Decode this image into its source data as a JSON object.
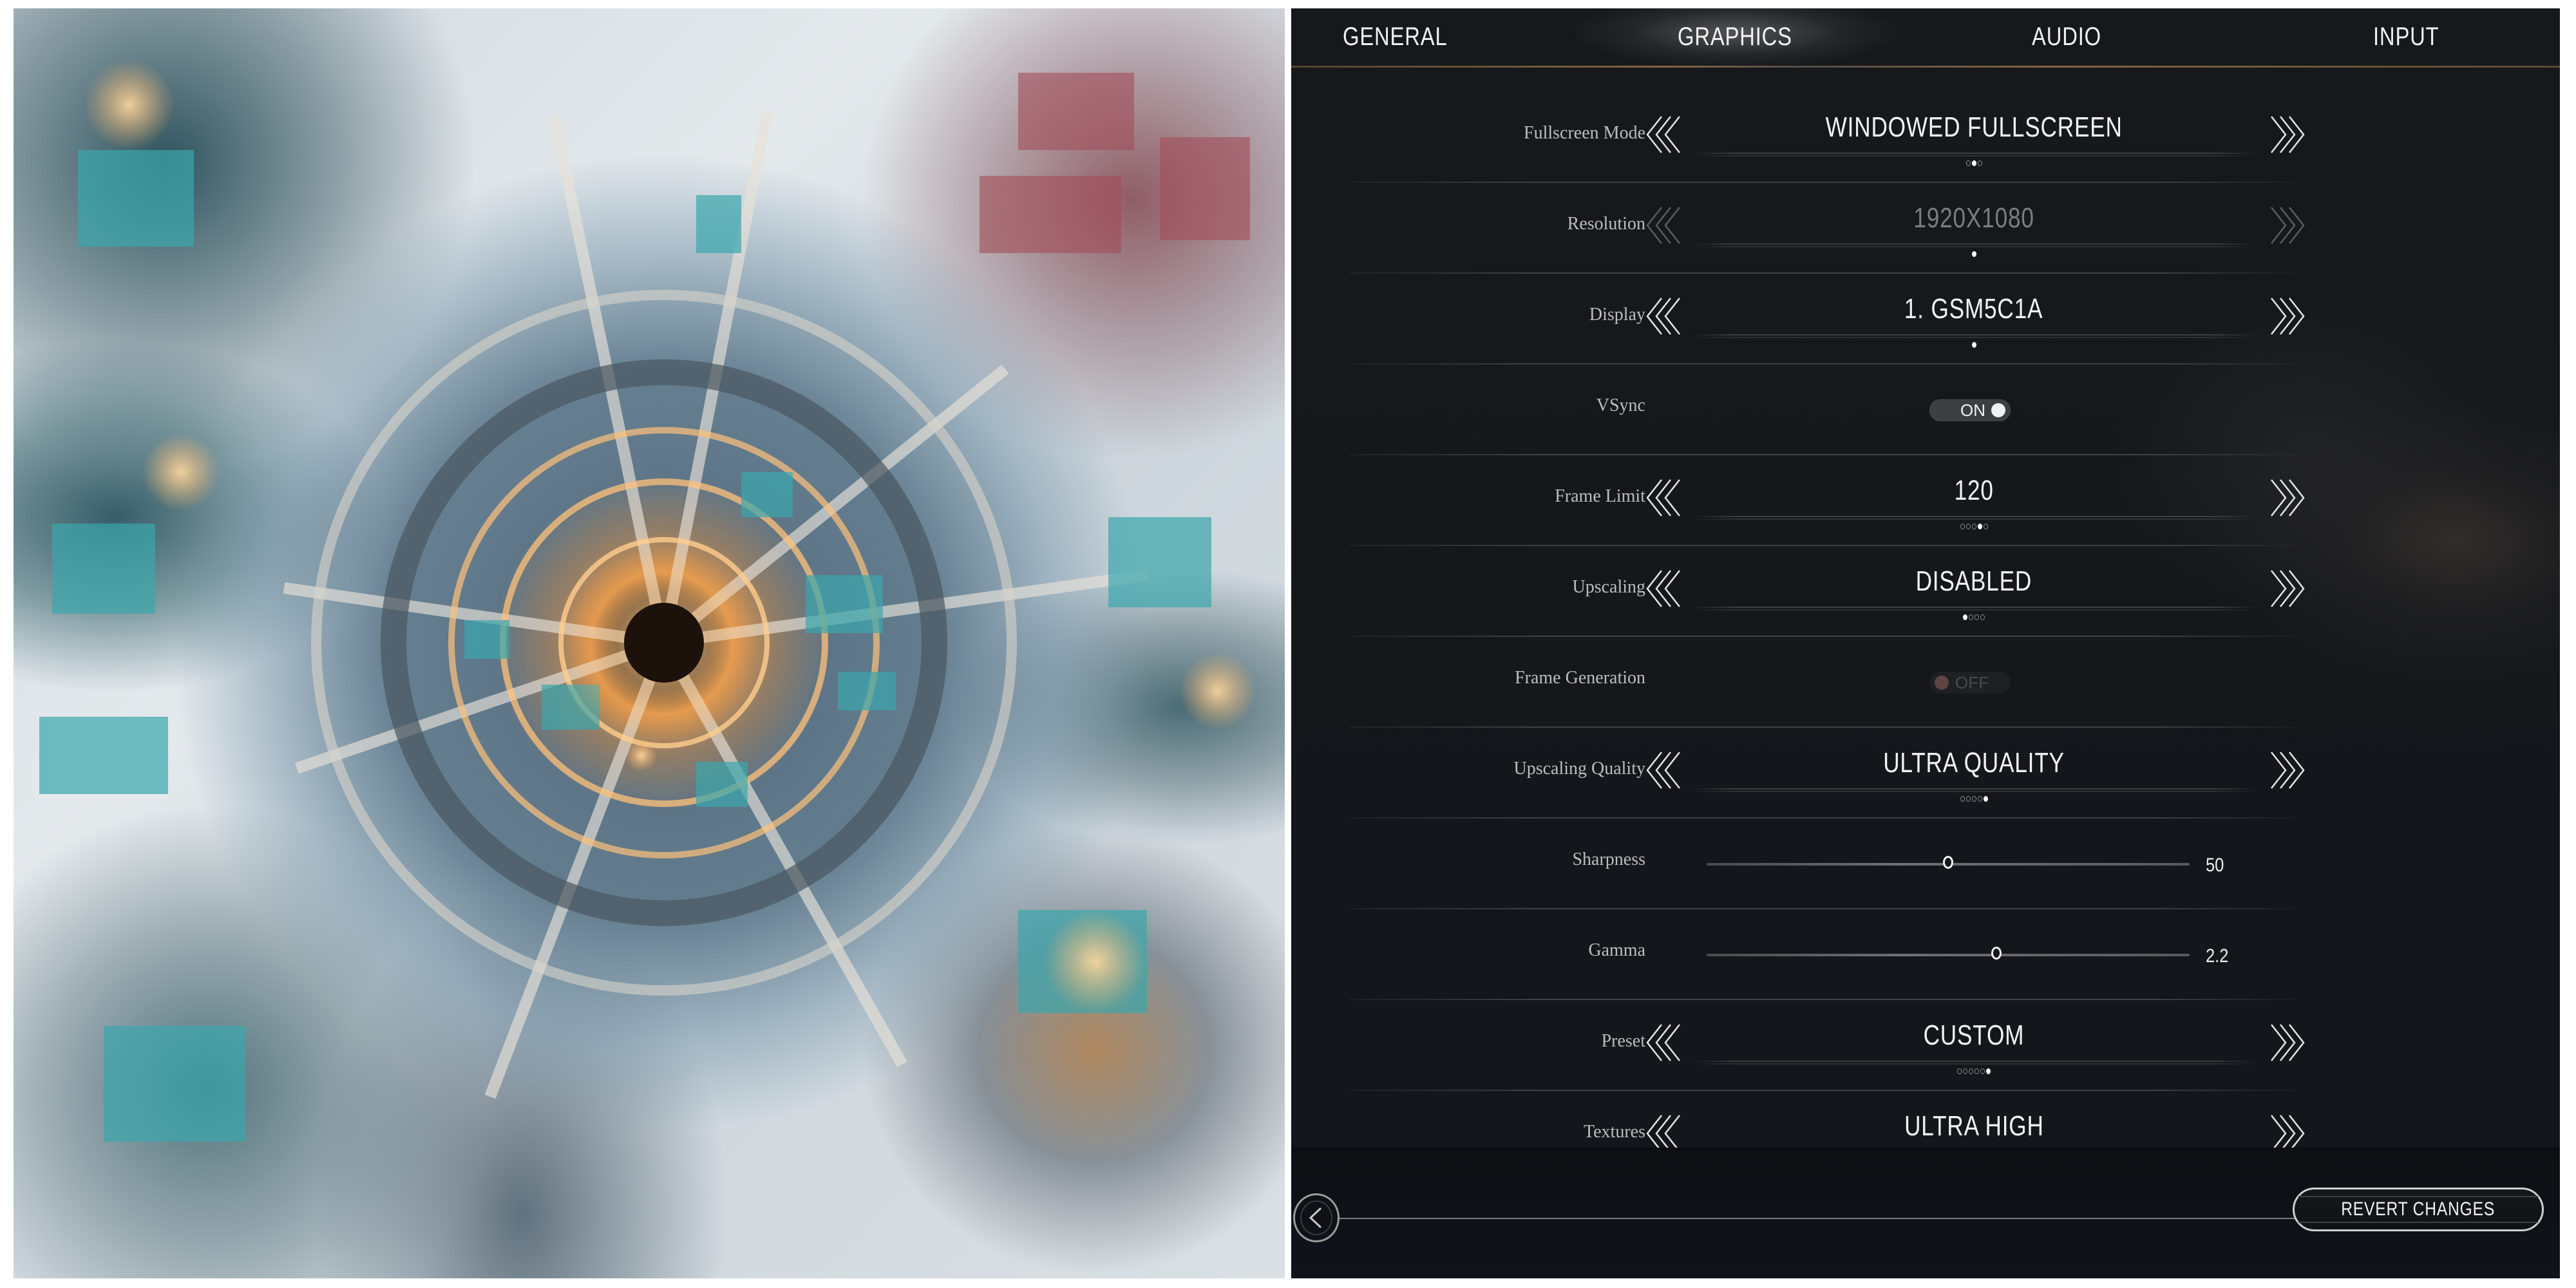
{
  "artwork": {
    "description": "Aerial view of a snowy frost-covered city with a glowing central generator"
  },
  "tabs": [
    {
      "label": "GENERAL",
      "active": false
    },
    {
      "label": "GRAPHICS",
      "active": true
    },
    {
      "label": "AUDIO",
      "active": false
    },
    {
      "label": "INPUT",
      "active": false
    }
  ],
  "settings": {
    "fullscreen_mode": {
      "label": "Fullscreen Mode",
      "value": "WINDOWED FULLSCREEN",
      "option_count": 3,
      "selected_index": 1,
      "enabled": true
    },
    "resolution": {
      "label": "Resolution",
      "value": "1920X1080",
      "option_count": 1,
      "selected_index": 0,
      "enabled": false
    },
    "display": {
      "label": "Display",
      "value": "1. GSM5C1A",
      "option_count": 1,
      "selected_index": 0,
      "enabled": true
    },
    "vsync": {
      "label": "VSync",
      "value": "ON",
      "state": true,
      "enabled": true
    },
    "frame_limit": {
      "label": "Frame Limit",
      "value": "120",
      "option_count": 5,
      "selected_index": 3,
      "enabled": true
    },
    "upscaling": {
      "label": "Upscaling",
      "value": "DISABLED",
      "option_count": 4,
      "selected_index": 0,
      "enabled": true
    },
    "frame_generation": {
      "label": "Frame Generation",
      "value": "OFF",
      "state": false,
      "enabled": false
    },
    "upscaling_quality": {
      "label": "Upscaling Quality",
      "value": "ULTRA QUALITY",
      "option_count": 5,
      "selected_index": 4,
      "enabled": true
    },
    "sharpness": {
      "label": "Sharpness",
      "value": "50",
      "fraction": 0.5
    },
    "gamma": {
      "label": "Gamma",
      "value": "2.2",
      "fraction": 0.6
    },
    "preset": {
      "label": "Preset",
      "value": "CUSTOM",
      "option_count": 6,
      "selected_index": 5,
      "enabled": true
    },
    "textures": {
      "label": "Textures",
      "value": "ULTRA HIGH",
      "enabled": true
    }
  },
  "footer": {
    "back_icon": "chevron-left-icon",
    "revert_label": "REVERT CHANGES"
  },
  "icons": {
    "prev": "double-chevron-left-icon",
    "next": "double-chevron-right-icon"
  },
  "colors": {
    "panel_bg": "#16181c",
    "accent_rule": "#a07848",
    "text": "#f2f2f2",
    "label": "#bdbdbd",
    "disabled_knob": "#7a5550"
  }
}
